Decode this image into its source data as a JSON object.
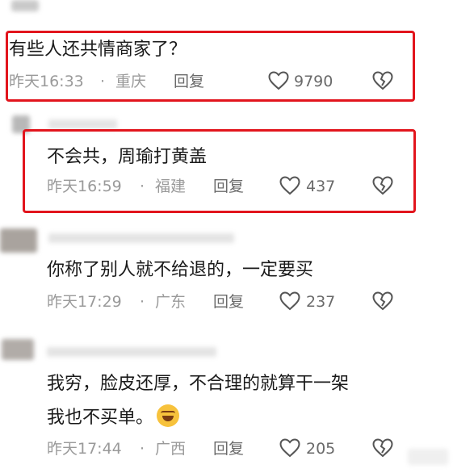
{
  "comments": [
    {
      "text": "有些人还共情商家了？",
      "time": "昨天16:33",
      "sep": "·",
      "location": "重庆",
      "reply": "回复",
      "likes": "9790"
    },
    {
      "text": "不会共，周瑜打黄盖",
      "time": "昨天16:59",
      "sep": "·",
      "location": "福建",
      "reply": "回复",
      "likes": "437"
    },
    {
      "text": "你称了别人就不给退的，一定要买",
      "time": "昨天17:29",
      "sep": "·",
      "location": "广东",
      "reply": "回复",
      "likes": "237"
    },
    {
      "text_line1": "我穷，脸皮还厚，不合理的就算干一架",
      "text_line2": "我也不买单。",
      "time": "昨天17:44",
      "sep": "·",
      "location": "广西",
      "reply": "回复",
      "likes": "205"
    }
  ],
  "colors": {
    "highlight_border": "#e2151d",
    "text": "#1a1a1a",
    "meta": "#9a9a9a"
  },
  "icons": [
    "heart-outline-icon",
    "broken-heart-icon",
    "laughing-emoji-icon"
  ]
}
